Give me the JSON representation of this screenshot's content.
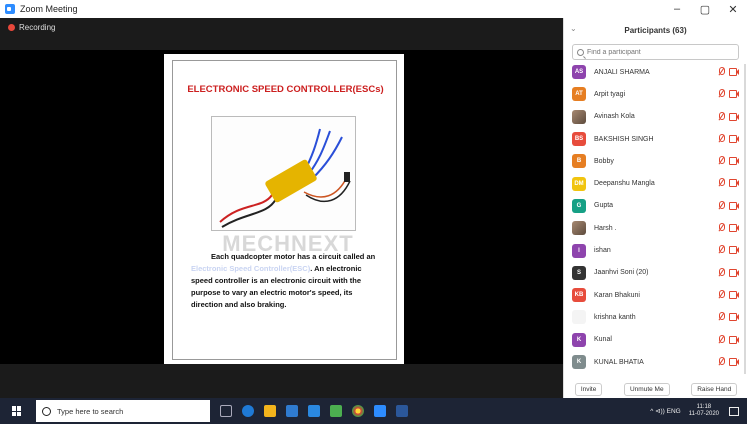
{
  "window": {
    "title": "Zoom Meeting",
    "controls": {
      "minimize": "–",
      "maximize": "▢",
      "close": "✕"
    }
  },
  "meeting": {
    "recording_label": "Recording",
    "slide": {
      "title": "ELECTRONIC SPEED CONTROLLER(ESCs)",
      "watermark": "MECHNEXT",
      "body_lead": "Each quadcopter motor has a circuit called an ",
      "body_faded": "Electronic Speed Controller(ESC)",
      "body_rest": ". An electronic speed controller is an electronic circuit with the purpose to vary an electric motor's speed, its direction and also braking."
    }
  },
  "participants_panel": {
    "title": "Participants (63)",
    "search_placeholder": "Find a participant",
    "participants": [
      {
        "initials": "AS",
        "name": "ANJALI SHARMA",
        "color": "#8e44ad"
      },
      {
        "initials": "AT",
        "name": "Arpit tyagi",
        "color": "#e67e22"
      },
      {
        "initials": "",
        "name": "Avinash Kola",
        "color": "photo"
      },
      {
        "initials": "BS",
        "name": "BAKSHISH SINGH",
        "color": "#e74c3c"
      },
      {
        "initials": "B",
        "name": "Bobby",
        "color": "#e67e22"
      },
      {
        "initials": "DM",
        "name": "Deepanshu Mangla",
        "color": "#f1c40f"
      },
      {
        "initials": "G",
        "name": "Gupta",
        "color": "#16a085"
      },
      {
        "initials": "",
        "name": "Harsh .",
        "color": "photo"
      },
      {
        "initials": "I",
        "name": "ishan",
        "color": "#8e44ad"
      },
      {
        "initials": "S",
        "name": "Jaanhvi Soni (20)",
        "color": "#333333"
      },
      {
        "initials": "KB",
        "name": "Karan Bhakuni",
        "color": "#e74c3c"
      },
      {
        "initials": "",
        "name": "krishna kanth",
        "color": "text"
      },
      {
        "initials": "K",
        "name": "Kunal",
        "color": "#8e44ad"
      },
      {
        "initials": "K",
        "name": "KUNAL BHATIA",
        "color": "#7f8c8d"
      }
    ],
    "footer": {
      "invite": "Invite",
      "unmute": "Unmute Me",
      "raise_hand": "Raise Hand"
    }
  },
  "taskbar": {
    "search_placeholder": "Type here to search",
    "tray_text": "^ ⊲)) ENG",
    "time": "11:18",
    "date": "11-07-2020"
  }
}
